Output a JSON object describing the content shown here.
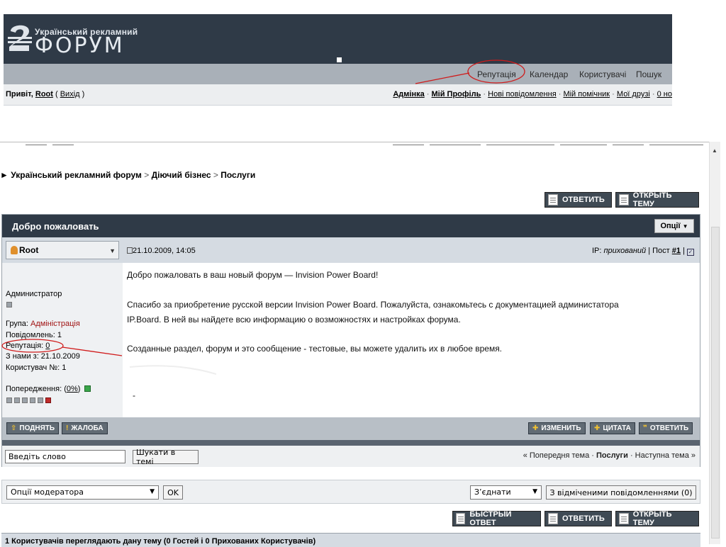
{
  "header": {
    "logo_small": "Український рекламний",
    "logo_big": "ФОРУМ"
  },
  "nav": {
    "items": [
      "Репутація",
      "Календар",
      "Користувачі",
      "Пошук"
    ]
  },
  "userbar": {
    "greeting_prefix": "Привіт,",
    "username": "Root",
    "logout": "Вихід",
    "links": [
      "Адмінка",
      "Мій Профіль",
      "Нові повідомлення",
      "Мій помічник",
      "Мої друзі",
      "0 но"
    ]
  },
  "breadcrumb": {
    "items": [
      "Український рекламний форум",
      "Діючий бізнес",
      "Послуги"
    ]
  },
  "top_buttons": {
    "reply": "ОТВЕТИТЬ",
    "new_topic": "ОТКРЫТЬ ТЕМУ"
  },
  "post": {
    "title": "Добро пожаловать",
    "options": "Опції",
    "author": "Root",
    "date": "21.10.2009, 14:05",
    "ip_label": "IP:",
    "ip_value": "прихований",
    "post_label": "| Пост",
    "post_number": "#1",
    "user_title": "Администратор",
    "group_label": "Група:",
    "group_value": "Адміністрація",
    "posts_label": "Повідомлень: 1",
    "reputation_label": "Репутація:",
    "reputation_value": "0",
    "joined": "З нами з: 21.10.2009",
    "user_number": "Користувач №: 1",
    "warnings_label": "Попередження: (",
    "warnings_value": "0%",
    "warnings_suffix": ")",
    "body": [
      "Добро пожаловать в ваш новый форум — Invision Power Board!",
      "Спасибо за приобретение русской версии Invision Power Board. Пожалуйста, ознакомьтесь с документацией администатора",
      "IP.Board. В ней вы найдете всю информацию о возможностях и настройках форума.",
      "Созданные раздел, форум и это сообщение - тестовые, вы можете удалить их в любое время."
    ],
    "signature": "-",
    "footer_left": [
      "ПОДНЯТЬ",
      "ЖАЛОБА"
    ],
    "footer_right": [
      "ИЗМЕНИТЬ",
      "ЦИТАТА",
      "ОТВЕТИТЬ"
    ]
  },
  "search": {
    "value": "Введіть слово",
    "button": "Шукати в темі"
  },
  "topic_nav": {
    "prev": "« Попередня тема",
    "current": "Послуги",
    "next": "Наступна тема »"
  },
  "moderation": {
    "select": "Опції модератора",
    "ok": "OK",
    "merge": "З’єднати",
    "selected": "З відміченими повідомленнями (0)"
  },
  "bottom_buttons": {
    "quick_reply": "БЫСТРЫЙ ОТВЕТ",
    "reply": "ОТВЕТИТЬ",
    "new_topic": "ОТКРЫТЬ ТЕМУ"
  },
  "viewers": "1 Користувачів переглядають дану тему (0 Гостей і 0 Прихованих Користувачів)",
  "colors": {
    "banner": "#2f3a47",
    "navbar": "#a9b0b8",
    "annotation": "#d01a1a",
    "group_red": "#a01212"
  }
}
